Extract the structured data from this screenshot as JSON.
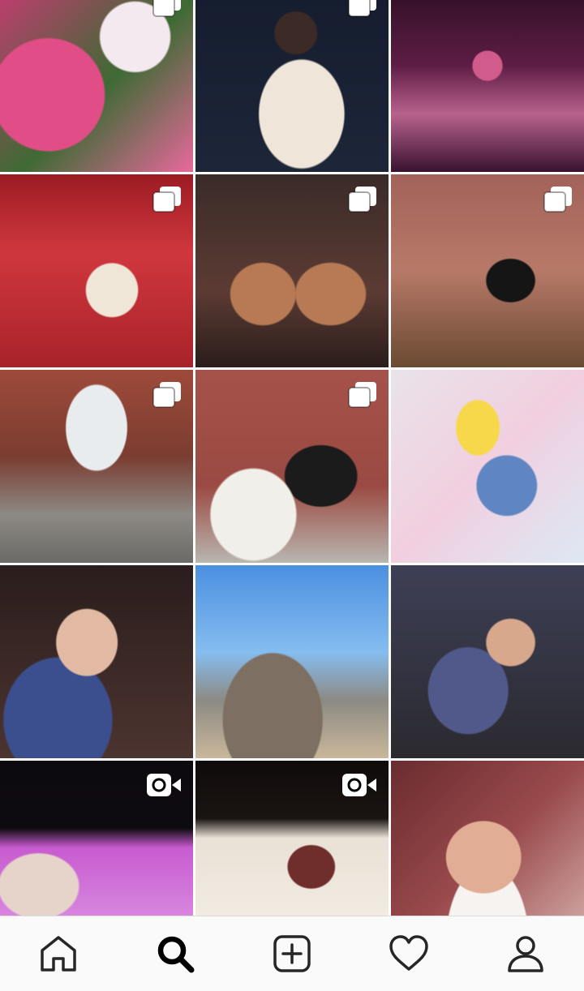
{
  "explore": {
    "tiles": [
      {
        "badge": "multi"
      },
      {
        "badge": "multi"
      },
      {
        "badge": "none"
      },
      {
        "badge": "multi"
      },
      {
        "badge": "multi"
      },
      {
        "badge": "multi"
      },
      {
        "badge": "multi"
      },
      {
        "badge": "multi"
      },
      {
        "badge": "none"
      },
      {
        "badge": "none"
      },
      {
        "badge": "none"
      },
      {
        "badge": "none"
      },
      {
        "badge": "video"
      },
      {
        "badge": "video"
      },
      {
        "badge": "none"
      }
    ]
  },
  "bottom_nav": {
    "active": "search",
    "items": [
      {
        "key": "home",
        "icon": "home-icon"
      },
      {
        "key": "search",
        "icon": "search-icon"
      },
      {
        "key": "new-post",
        "icon": "plus-square-icon"
      },
      {
        "key": "activity",
        "icon": "heart-icon"
      },
      {
        "key": "profile",
        "icon": "person-icon"
      }
    ]
  }
}
